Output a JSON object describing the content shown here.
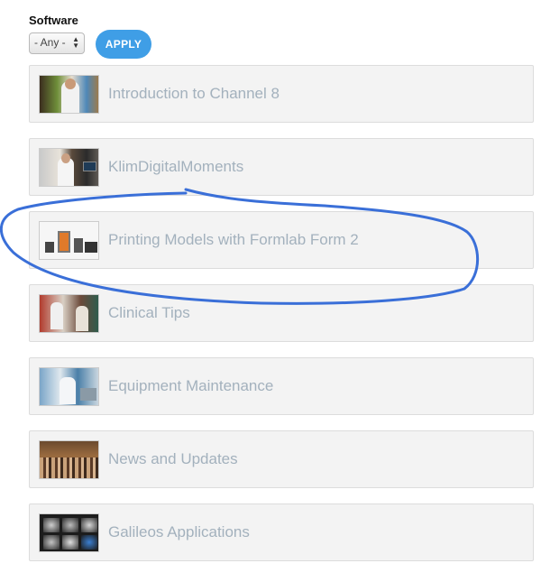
{
  "filter": {
    "label": "Software",
    "select_value": "- Any -",
    "apply_label": "APPLY"
  },
  "videos": [
    {
      "title": "Introduction to Channel 8",
      "thumbnail": "presenter-in-lab-coat"
    },
    {
      "title": "KlimDigitalMoments",
      "thumbnail": "presenter-with-monitors"
    },
    {
      "title": "Printing Models with Formlab Form 2",
      "thumbnail": "3d-printer-setup"
    },
    {
      "title": "Clinical Tips",
      "thumbnail": "clinicians-at-work"
    },
    {
      "title": "Equipment Maintenance",
      "thumbnail": "technician-at-bench"
    },
    {
      "title": "News and Updates",
      "thumbnail": "conference-audience"
    },
    {
      "title": "Galileos Applications",
      "thumbnail": "ct-scan-views"
    }
  ],
  "annotation": {
    "shape": "hand-drawn ellipse",
    "color": "#3a6fd8",
    "target": "Printing Models with Formlab Form 2"
  }
}
